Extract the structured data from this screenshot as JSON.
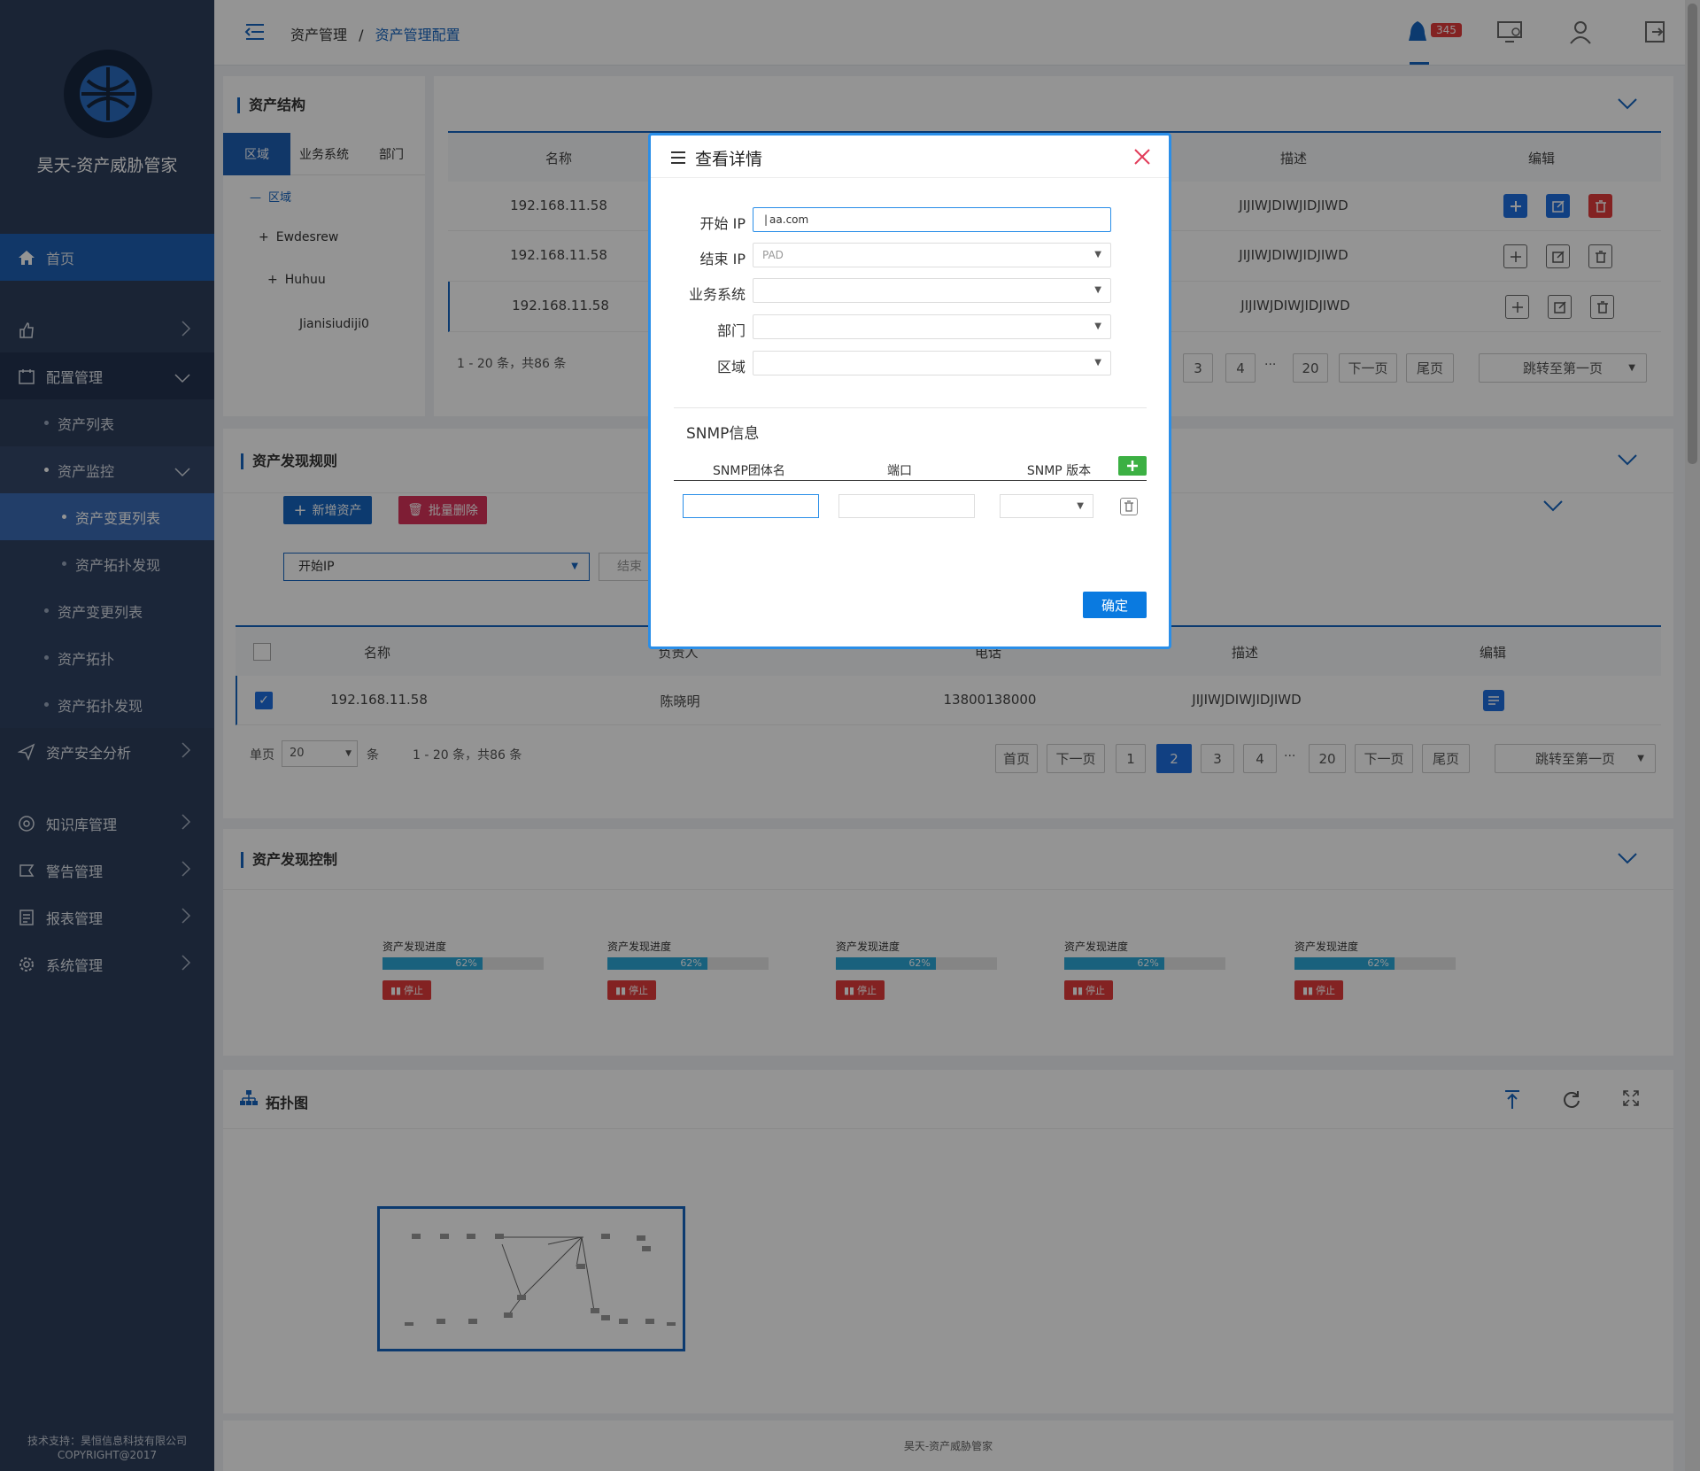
{
  "sidebar": {
    "app_name": "昊天-资产威胁管家",
    "items": [
      {
        "label": "首页"
      },
      {
        "label": ""
      },
      {
        "label": "配置管理"
      },
      {
        "label": "资产列表"
      },
      {
        "label": "资产监控"
      },
      {
        "label": "资产变更列表"
      },
      {
        "label": "资产拓扑发现"
      },
      {
        "label": "资产变更列表"
      },
      {
        "label": "资产拓扑"
      },
      {
        "label": "资产拓扑发现"
      },
      {
        "label": "资产安全分析"
      },
      {
        "label": "知识库管理"
      },
      {
        "label": "警告管理"
      },
      {
        "label": "报表管理"
      },
      {
        "label": "系统管理"
      }
    ],
    "footer_line1": "技术支持：昊恒信息科技有限公司",
    "footer_line2": "COPYRIGHT@2017"
  },
  "topbar": {
    "breadcrumb_root": "资产管理",
    "breadcrumb_sep": "/",
    "breadcrumb_current": "资产管理配置",
    "notification_count": "345"
  },
  "structure": {
    "title": "资产结构",
    "tabs": [
      "区域",
      "业务系统",
      "部门"
    ],
    "tree": [
      "区域",
      "Ewdesrew",
      "Huhuu",
      "Jianisiudiji0"
    ]
  },
  "top_table": {
    "headers": [
      "名称",
      "描述",
      "编辑"
    ],
    "rows": [
      {
        "name": "192.168.11.58",
        "desc": "JIJIWJDIWJIDJIWD"
      },
      {
        "name": "192.168.11.58",
        "desc": "JIJIWJDIWJIDJIWD"
      },
      {
        "name": "192.168.11.58",
        "desc": "JIJIWJDIWJIDJIWD"
      }
    ],
    "info": "1 - 20 条，共86 条",
    "pages": [
      "3",
      "4",
      "···",
      "20",
      "下一页",
      "尾页"
    ],
    "jump": "跳转至第一页"
  },
  "rules": {
    "title": "资产发现规则",
    "add_btn": "新增资产",
    "batch_delete_btn": "批量删除",
    "start_ip_placeholder": "开始IP",
    "end_placeholder": "结束",
    "headers": [
      "名称",
      "负责人",
      "电话",
      "描述",
      "编辑"
    ],
    "row": {
      "name": "192.168.11.58",
      "owner": "陈晓明",
      "phone": "13800138000",
      "desc": "JIJIWJDIWJIDJIWD"
    },
    "page_size_label": "单页",
    "page_size": "20",
    "page_size_unit": "条",
    "info": "1 - 20 条，共86 条",
    "pages": [
      "首页",
      "下一页",
      "1",
      "2",
      "3",
      "4",
      "···",
      "20",
      "下一页",
      "尾页"
    ],
    "jump": "跳转至第一页"
  },
  "control": {
    "title": "资产发现控制",
    "items": [
      {
        "label": "资产发现进度",
        "percent": 62,
        "percent_text": "62%",
        "stop": "停止"
      },
      {
        "label": "资产发现进度",
        "percent": 62,
        "percent_text": "62%",
        "stop": "停止"
      },
      {
        "label": "资产发现进度",
        "percent": 62,
        "percent_text": "62%",
        "stop": "停止"
      },
      {
        "label": "资产发现进度",
        "percent": 62,
        "percent_text": "62%",
        "stop": "停止"
      },
      {
        "label": "资产发现进度",
        "percent": 62,
        "percent_text": "62%",
        "stop": "停止"
      }
    ]
  },
  "topology": {
    "title": "拓扑图"
  },
  "footer": {
    "text": "昊天-资产威胁管家"
  },
  "modal": {
    "title": "查看详情",
    "start_ip_label": "开始 IP",
    "start_ip_value": "aa.com",
    "end_ip_label": "结束 IP",
    "end_ip_value": "PAD",
    "biz_label": "业务系统",
    "dept_label": "部门",
    "area_label": "区域",
    "snmp_section": "SNMP信息",
    "snmp_headers": [
      "SNMP团体名",
      "端口",
      "SNMP 版本"
    ],
    "confirm": "确定"
  },
  "colors": {
    "sidebar": "#2d3e5c",
    "accent": "#1565c0",
    "danger": "#e23c3c",
    "success": "#3cb043",
    "modal_border": "#2a8ee8"
  }
}
